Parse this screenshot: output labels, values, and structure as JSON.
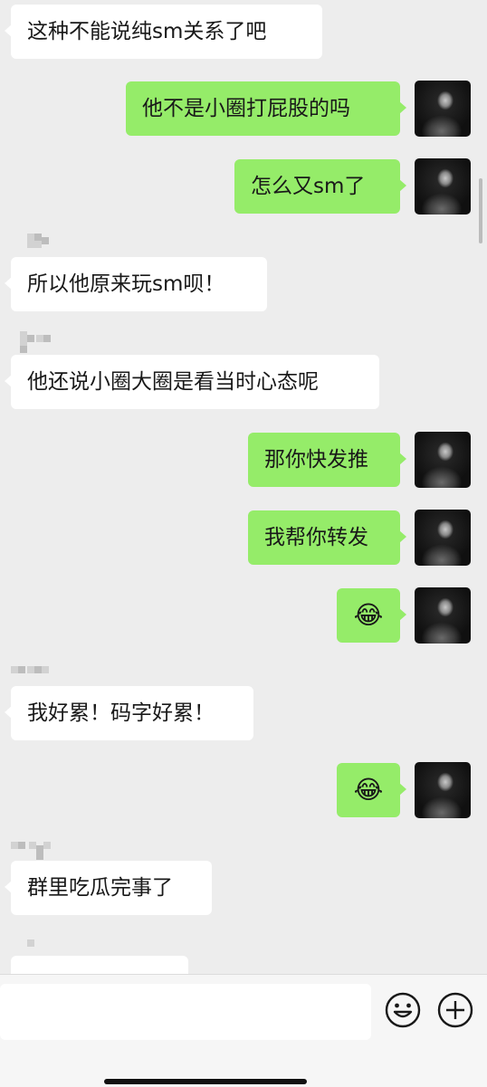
{
  "messages": [
    {
      "direction": "in",
      "text": "这种不能说纯sm关系了吧"
    },
    {
      "direction": "out",
      "text": "他不是小圈打屁股的吗"
    },
    {
      "direction": "out",
      "text": "怎么又sm了"
    },
    {
      "direction": "in",
      "text": "所以他原来玩sm呗！"
    },
    {
      "direction": "in",
      "text": "他还说小圈大圈是看当时心态呢"
    },
    {
      "direction": "out",
      "text": "那你快发推"
    },
    {
      "direction": "out",
      "text": "我帮你转发"
    },
    {
      "direction": "out",
      "text": "😂"
    },
    {
      "direction": "in",
      "text": "我好累！码字好累！"
    },
    {
      "direction": "out",
      "text": "😂"
    },
    {
      "direction": "in",
      "text": "群里吃瓜完事了"
    }
  ],
  "input_bar": {
    "icons": [
      "emoji-icon",
      "plus-icon"
    ]
  },
  "colors": {
    "background": "#ededed",
    "incoming_bubble": "#ffffff",
    "outgoing_bubble": "#95ec69"
  }
}
